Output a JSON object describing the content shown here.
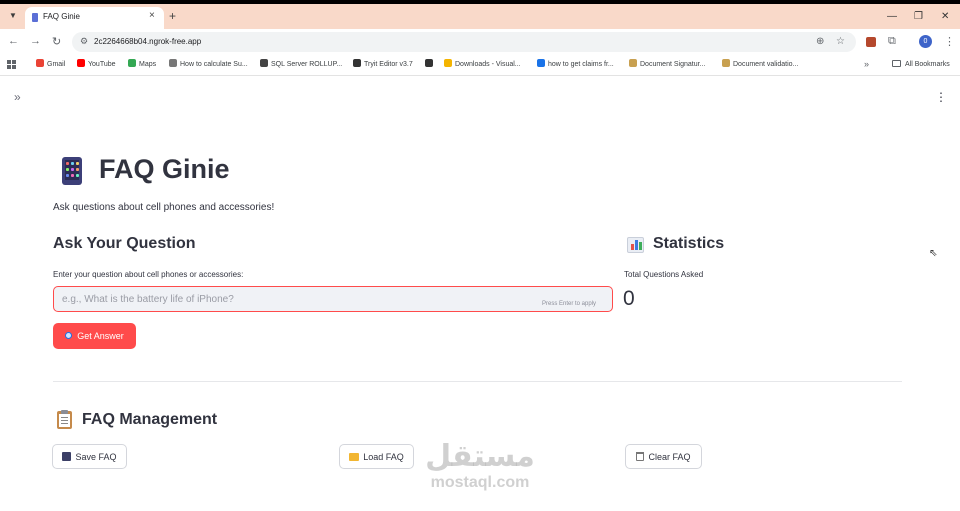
{
  "browser": {
    "tab_title": "FAQ Ginie",
    "tab_close": "×",
    "new_tab": "+",
    "url": "2c2264668b04.ngrok-free.app",
    "profile_initial": "0",
    "bookmarks": [
      {
        "label": "Gmail",
        "color": "#ea4335"
      },
      {
        "label": "YouTube",
        "color": "#ff0000"
      },
      {
        "label": "Maps",
        "color": "#34a853"
      },
      {
        "label": "How to calculate Su...",
        "color": "#777777"
      },
      {
        "label": "SQL Server ROLLUP...",
        "color": "#444444"
      },
      {
        "label": "Tryit Editor v3.7",
        "color": "#333333"
      },
      {
        "label": "",
        "color": "#333333"
      },
      {
        "label": "Downloads - Visual...",
        "color": "#f4b400"
      },
      {
        "label": "how to get claims fr...",
        "color": "#1a73e8"
      },
      {
        "label": "Document Signatur...",
        "color": "#c8a050"
      },
      {
        "label": "Document validatio...",
        "color": "#c8a050"
      }
    ],
    "all_bookmarks": "All Bookmarks"
  },
  "app": {
    "title": "FAQ Ginie",
    "caption": "Ask questions about cell phones and accessories!",
    "ask": {
      "heading": "Ask Your Question",
      "field_label": "Enter your question about cell phones or accessories:",
      "placeholder": "e.g., What is the battery life of iPhone?",
      "enter_hint": "Press Enter to apply",
      "button_label": "Get Answer"
    },
    "stats": {
      "heading": "Statistics",
      "metric_label": "Total Questions Asked",
      "metric_value": "0"
    },
    "faq": {
      "heading": "FAQ Management",
      "save_label": "Save FAQ",
      "load_label": "Load FAQ",
      "clear_label": "Clear FAQ"
    }
  },
  "watermark": {
    "arabic": "مستقل",
    "latin": "mostaql.com"
  },
  "colors": {
    "primary": "#ff4b4b",
    "tabstrip": "#f9d9c9",
    "text": "#31333f"
  }
}
